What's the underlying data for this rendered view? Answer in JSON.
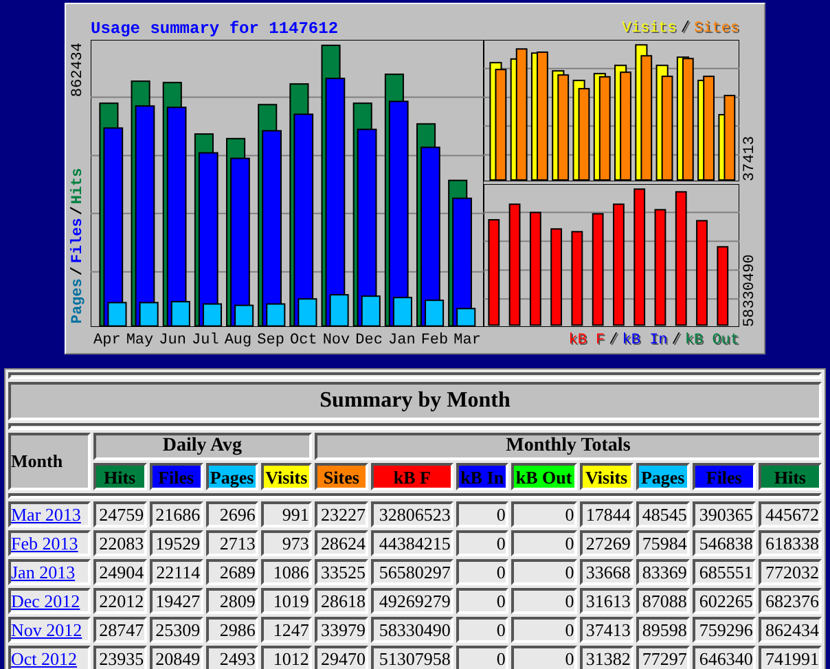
{
  "usage_chart": {
    "title": "Usage summary for 1147612",
    "main_max": "862434",
    "main_legend": {
      "separator": "/",
      "items": [
        {
          "label": "Pages",
          "color": "#0070a0"
        },
        {
          "label": "Files",
          "color": "#0000ff"
        },
        {
          "label": "Hits",
          "color": "#008040"
        }
      ]
    },
    "months": [
      "Apr",
      "May",
      "Jun",
      "Jul",
      "Aug",
      "Sep",
      "Oct",
      "Nov",
      "Dec",
      "Jan",
      "Feb",
      "Mar"
    ],
    "visits_legend": {
      "separator": "/",
      "items": [
        {
          "label": "Visits",
          "color": "#ffff00"
        },
        {
          "label": "Sites",
          "color": "#ff8000"
        }
      ]
    },
    "visits_max": "37413",
    "kb_max": "58330490",
    "kb_legend": {
      "separator": "/",
      "items": [
        {
          "label": "kB F",
          "color": "#ff0000"
        },
        {
          "label": "kB In",
          "color": "#0000ff"
        },
        {
          "label": "kB Out",
          "color": "#008040"
        }
      ]
    }
  },
  "summary_table": {
    "title": "Summary by Month",
    "month_header": "Month",
    "groups": [
      {
        "label": "Daily Avg",
        "columns": [
          {
            "label": "Hits",
            "color": "#008040"
          },
          {
            "label": "Files",
            "color": "#0000ff"
          },
          {
            "label": "Pages",
            "color": "#00c0ff"
          },
          {
            "label": "Visits",
            "color": "#ffff00"
          }
        ]
      },
      {
        "label": "Monthly Totals",
        "columns": [
          {
            "label": "Sites",
            "color": "#ff8000"
          },
          {
            "label": "kB F",
            "color": "#ff0000"
          },
          {
            "label": "kB In",
            "color": "#0000ff"
          },
          {
            "label": "kB Out",
            "color": "#00ff00"
          },
          {
            "label": "Visits",
            "color": "#ffff00"
          },
          {
            "label": "Pages",
            "color": "#00c0ff"
          },
          {
            "label": "Files",
            "color": "#0000ff"
          },
          {
            "label": "Hits",
            "color": "#008040"
          }
        ]
      }
    ],
    "rows": [
      {
        "month": "Mar 2013",
        "values": [
          "24759",
          "21686",
          "2696",
          "991",
          "23227",
          "32806523",
          "0",
          "0",
          "17844",
          "48545",
          "390365",
          "445672"
        ]
      },
      {
        "month": "Feb 2013",
        "values": [
          "22083",
          "19529",
          "2713",
          "973",
          "28624",
          "44384215",
          "0",
          "0",
          "27269",
          "75984",
          "546838",
          "618338"
        ]
      },
      {
        "month": "Jan 2013",
        "values": [
          "24904",
          "22114",
          "2689",
          "1086",
          "33525",
          "56580297",
          "0",
          "0",
          "33668",
          "83369",
          "685551",
          "772032"
        ]
      },
      {
        "month": "Dec 2012",
        "values": [
          "22012",
          "19427",
          "2809",
          "1019",
          "28618",
          "49269279",
          "0",
          "0",
          "31613",
          "87088",
          "602265",
          "682376"
        ]
      },
      {
        "month": "Nov 2012",
        "values": [
          "28747",
          "25309",
          "2986",
          "1247",
          "33979",
          "58330490",
          "0",
          "0",
          "37413",
          "89598",
          "759296",
          "862434"
        ]
      },
      {
        "month": "Oct 2012",
        "values": [
          "23935",
          "20849",
          "2493",
          "1012",
          "29470",
          "51307958",
          "0",
          "0",
          "31382",
          "77297",
          "646340",
          "741991"
        ]
      }
    ]
  }
}
